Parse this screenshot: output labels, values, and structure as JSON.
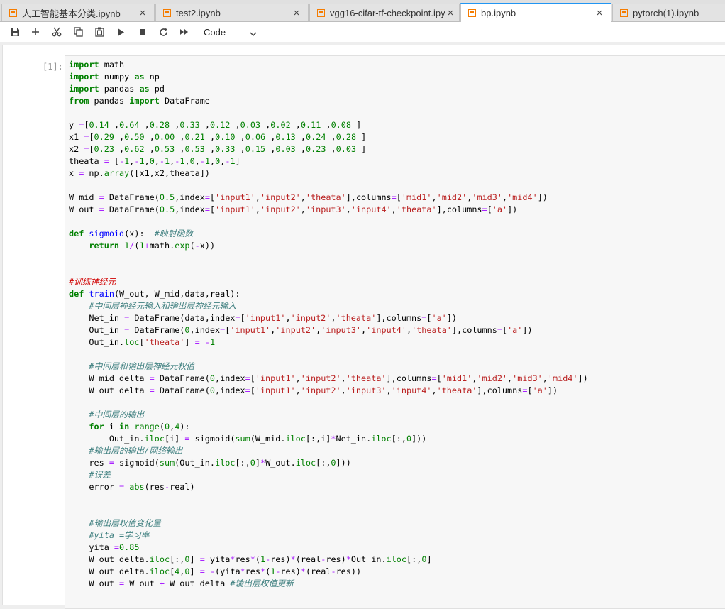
{
  "tabs": [
    {
      "label": "人工智能基本分类.ipynb",
      "close": "×"
    },
    {
      "label": "test2.ipynb",
      "close": "×"
    },
    {
      "label": "vgg16-cifar-tf-checkpoint.ipy",
      "close": "×"
    },
    {
      "label": "bp.ipynb",
      "close": "×"
    },
    {
      "label": "pytorch(1).ipynb"
    }
  ],
  "toolbar": {
    "buttons": [
      "save-icon",
      "add-cell-icon",
      "cut-icon",
      "copy-icon",
      "paste-icon",
      "run-icon",
      "stop-icon",
      "restart-icon",
      "run-all-icon"
    ],
    "cell_type": "Code"
  },
  "cell": {
    "prompt": "[1]:",
    "code": [
      "import math",
      "import numpy as np",
      "import pandas as pd",
      "from pandas import DataFrame",
      "",
      "y =[0.14 ,0.64 ,0.28 ,0.33 ,0.12 ,0.03 ,0.02 ,0.11 ,0.08 ]",
      "x1 =[0.29 ,0.50 ,0.00 ,0.21 ,0.10 ,0.06 ,0.13 ,0.24 ,0.28 ]",
      "x2 =[0.23 ,0.62 ,0.53 ,0.53 ,0.33 ,0.15 ,0.03 ,0.23 ,0.03 ]",
      "theata = [-1,-1,0,-1,-1,0,-1,0,-1]",
      "x = np.array([x1,x2,theata])",
      "",
      "W_mid = DataFrame(0.5,index=['input1','input2','theata'],columns=['mid1','mid2','mid3','mid4'])",
      "W_out = DataFrame(0.5,index=['input1','input2','input3','input4','theata'],columns=['a'])",
      "",
      "def sigmoid(x):  #映射函数",
      "    return 1/(1+math.exp(-x))",
      "",
      "",
      "#训练神经元",
      "def train(W_out, W_mid,data,real):",
      "    #中间层神经元输入和输出层神经元输入",
      "    Net_in = DataFrame(data,index=['input1','input2','theata'],columns=['a'])",
      "    Out_in = DataFrame(0,index=['input1','input2','input3','input4','theata'],columns=['a'])",
      "    Out_in.loc['theata'] = -1",
      "",
      "    #中间层和输出层神经元权值",
      "    W_mid_delta = DataFrame(0,index=['input1','input2','theata'],columns=['mid1','mid2','mid3','mid4'])",
      "    W_out_delta = DataFrame(0,index=['input1','input2','input3','input4','theata'],columns=['a'])",
      "",
      "    #中间层的输出",
      "    for i in range(0,4):",
      "        Out_in.iloc[i] = sigmoid(sum(W_mid.iloc[:,i]*Net_in.iloc[:,0]))",
      "    #输出层的输出/网络输出",
      "    res = sigmoid(sum(Out_in.iloc[:,0]*W_out.iloc[:,0]))",
      "    #误差",
      "    error = abs(res-real)",
      "",
      "",
      "    #输出层权值变化量",
      "    #yita =学习率",
      "    yita =0.85",
      "    W_out_delta.iloc[:,0] = yita*res*(1-res)*(real-res)*Out_in.iloc[:,0]",
      "    W_out_delta.iloc[4,0] = -(yita*res*(1-res)*(real-res))",
      "    W_out = W_out + W_out_delta #输出层权值更新"
    ]
  }
}
